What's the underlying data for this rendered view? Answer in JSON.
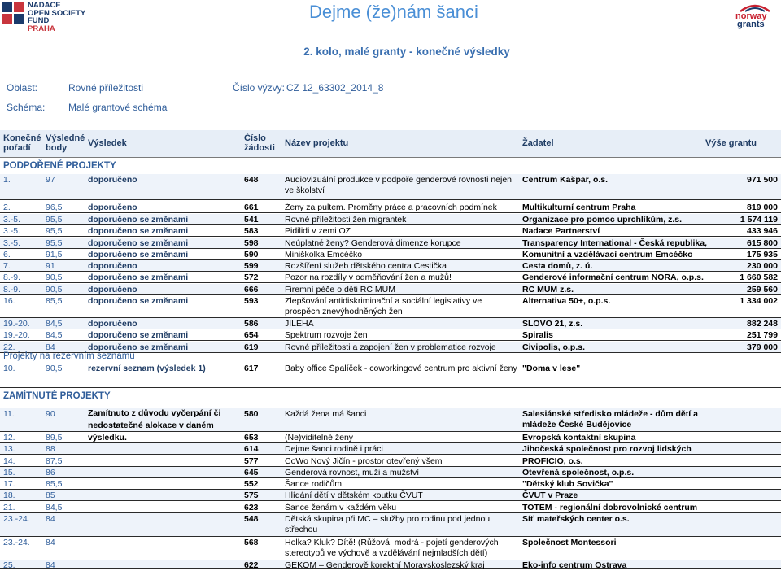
{
  "header": {
    "logo_left_lines": [
      "NADACE",
      "OPEN SOCIETY FUND",
      "PRAHA"
    ],
    "title": "Dejme (že)nám šanci",
    "logo_right_lines": [
      "norway",
      "grants"
    ]
  },
  "subtitle": "2. kolo, malé granty - konečné výsledky",
  "meta": {
    "area_label": "Oblast:",
    "area_value": "Rovné příležitosti",
    "call_label": "Číslo výzvy:",
    "call_value": "CZ 12_63302_2014_8",
    "scheme_label": "Schéma:",
    "scheme_value": "Malé grantové schéma"
  },
  "columns": {
    "rank": "Konečné pořadí",
    "score": "Výsledné body",
    "result": "Výsledek",
    "num": "Číslo žádosti",
    "name": "Název projektu",
    "applicant": "Žadatel",
    "amount": "Výše grantu"
  },
  "sections": {
    "supported": "PODPOŘENÉ PROJEKTY",
    "reserve": "Projekty na rezervním seznamu",
    "rejected": "ZAMÍTNUTÉ PROJEKTY"
  },
  "supported_rows": [
    {
      "rank": "1.",
      "score": "97",
      "result": "doporučeno",
      "num": "648",
      "name": "Audiovizuální produkce v podpoře genderové rovnosti nejen ve školství",
      "applicant": "Centrum Kašpar, o.s.",
      "amount": "971 500"
    },
    {
      "rank": "2.",
      "score": "96,5",
      "result": "doporučeno",
      "num": "661",
      "name": "Ženy za pultem. Proměny práce a pracovních podmínek",
      "applicant": "Multikulturní centrum Praha",
      "amount": "819 000"
    },
    {
      "rank": "3.-5.",
      "score": "95,5",
      "result": "doporučeno se změnami",
      "num": "541",
      "name": "Rovné příležitosti žen migrantek",
      "applicant": "Organizace pro pomoc uprchlíkům, z.s.",
      "amount": "1 574 119"
    },
    {
      "rank": "3.-5.",
      "score": "95,5",
      "result": "doporučeno se změnami",
      "num": "583",
      "name": "Pidilidi v zemi OZ",
      "applicant": "Nadace Partnerství",
      "amount": "433 946"
    },
    {
      "rank": "3.-5.",
      "score": "95,5",
      "result": "doporučeno se změnami",
      "num": "598",
      "name": "Neúplatné ženy? Genderová dimenze korupce",
      "applicant": "Transparency International - Česká republika, o.p.s.",
      "amount": "615 800"
    },
    {
      "rank": "6.",
      "score": "91,5",
      "result": "doporučeno se změnami",
      "num": "590",
      "name": "Miniškolka Emcéčko",
      "applicant": "Komunitní a vzdělávací centrum Emcéčko",
      "amount": "175 935"
    },
    {
      "rank": "7.",
      "score": "91",
      "result": "doporučeno",
      "num": "599",
      "name": "Rozšíření služeb dětského centra Cestička",
      "applicant": "Cesta domů, z. ú.",
      "amount": "230 000"
    },
    {
      "rank": "8.-9.",
      "score": "90,5",
      "result": "doporučeno se změnami",
      "num": "572",
      "name": "Pozor na rozdíly v odměňování žen a mužů!",
      "applicant": "Genderové informační centrum NORA, o.p.s.",
      "amount": "1 660 582"
    },
    {
      "rank": "8.-9.",
      "score": "90,5",
      "result": "doporučeno",
      "num": "666",
      "name": "Firemní péče o děti RC MUM",
      "applicant": "RC MUM z.s.",
      "amount": "259 560"
    },
    {
      "rank": "16.",
      "score": "85,5",
      "result": "doporučeno se změnami",
      "num": "593",
      "name": "Zlepšování antidiskriminační a sociální legislativy ve prospěch znevýhodněných žen",
      "applicant": "Alternativa 50+, o.p.s.",
      "amount": "1 334 002"
    },
    {
      "rank": "19.-20.",
      "score": "84,5",
      "result": "doporučeno",
      "num": "586",
      "name": "JILEHA",
      "applicant": "SLOVO 21, z.s.",
      "amount": "882 248"
    },
    {
      "rank": "19.-20.",
      "score": "84,5",
      "result": "doporučeno se změnami",
      "num": "654",
      "name": "Spektrum rozvoje žen",
      "applicant": "Spiralis",
      "amount": "251 799"
    },
    {
      "rank": "22.",
      "score": "84",
      "result": "doporučeno se změnami",
      "num": "619",
      "name": "Rovné příležitosti a zapojení žen v problematice rozvoje",
      "applicant": "Civipolis, o.p.s.",
      "amount": "379 000"
    }
  ],
  "reserve_rows": [
    {
      "rank": "10.",
      "score": "90,5",
      "result": "rezervní seznam (výsledek 1)",
      "num": "617",
      "name": "Baby office Špalíček - coworkingové centrum pro aktivní ženy",
      "applicant": "\"Doma v lese\"",
      "amount": ""
    }
  ],
  "rejected_result": "Zamítnuto z důvodu vyčerpání či nedostatečné alokace v daném výsledku.",
  "rejected_rows": [
    {
      "rank": "11.",
      "score": "90",
      "num": "580",
      "name": "Každá žena má šanci",
      "applicant": "Salesiánské středisko mládeže - dům dětí a mládeže České Budějovice"
    },
    {
      "rank": "12.",
      "score": "89,5",
      "num": "653",
      "name": "(Ne)viditelné ženy",
      "applicant": "Evropská kontaktní skupina"
    },
    {
      "rank": "13.",
      "score": "88",
      "num": "614",
      "name": "Dejme šanci rodině i práci",
      "applicant": "Jihočeská společnost pro rozvoj lidských zdrojů"
    },
    {
      "rank": "14.",
      "score": "87,5",
      "num": "577",
      "name": "CoWo Nový Jičín - prostor otevřený všem",
      "applicant": "PROFICIO, o.s."
    },
    {
      "rank": "15.",
      "score": "86",
      "num": "645",
      "name": "Genderová rovnost, muži a mužství",
      "applicant": "Otevřená společnost, o.p.s."
    },
    {
      "rank": "17.",
      "score": "85,5",
      "num": "552",
      "name": "Šance rodičům",
      "applicant": "\"Dětský klub Sovička\""
    },
    {
      "rank": "18.",
      "score": "85",
      "num": "575",
      "name": "Hlídání dětí v dětském koutku ČVUT",
      "applicant": "ČVUT v Praze"
    },
    {
      "rank": "21.",
      "score": "84,5",
      "num": "623",
      "name": "Šance ženám v každém věku",
      "applicant": "TOTEM - regionální dobrovolnické centrum"
    },
    {
      "rank": "23.-24.",
      "score": "84",
      "num": "548",
      "name": "Dětská skupina při MC – služby pro rodinu pod jednou střechou",
      "applicant": "Síť mateřských center o.s."
    },
    {
      "rank": "23.-24.",
      "score": "84",
      "num": "568",
      "name": "Holka? Kluk? Dítě! (Růžová, modrá - pojetí genderových stereotypů ve výchově a vzdělávání nejmladších dětí)",
      "applicant": "Společnost Montessori"
    },
    {
      "rank": "25.",
      "score": "84",
      "num": "622",
      "name": "GEKOM – Genderově korektní Moravskoslezský kraj",
      "applicant": "Eko-info centrum Ostrava"
    }
  ],
  "colors": {
    "accent_blue": "#4a8fd6",
    "heading_blue": "#3a6fb0",
    "text_blue": "#2f5d9a",
    "logo_red": "#c8353d"
  }
}
